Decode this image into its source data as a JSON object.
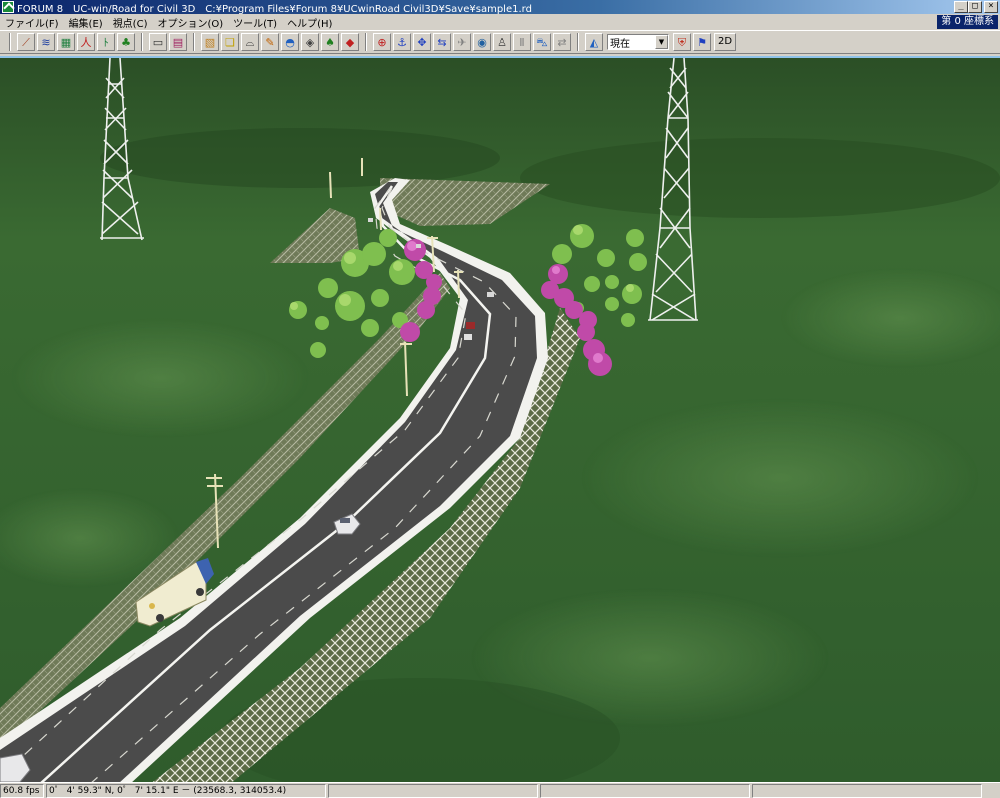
{
  "window": {
    "title": "FORUM 8　UC-win/Road for Civil 3D　C:¥Program Files¥Forum 8¥UCwinRoad Civil3D¥Save¥sample1.rd"
  },
  "menu": {
    "items": [
      "ファイル(F)",
      "編集(E)",
      "視点(C)",
      "オプション(O)",
      "ツール(T)",
      "ヘルプ(H)"
    ],
    "coord_system": "第 0 座標系"
  },
  "toolbar": {
    "view_select_value": "現在",
    "mode_2d_label": "2D"
  },
  "status": {
    "fps": "60.8 fps",
    "position": "0゜ 4' 59.3\" N, 0゜ 7' 15.1\" E － (23568.3, 314053.4)"
  },
  "colors": {
    "title_bar": "#0a246a",
    "viewport_sky_line": "#8ec2e8",
    "grass": "#2f5f2a",
    "road": "#4b4b4b"
  }
}
